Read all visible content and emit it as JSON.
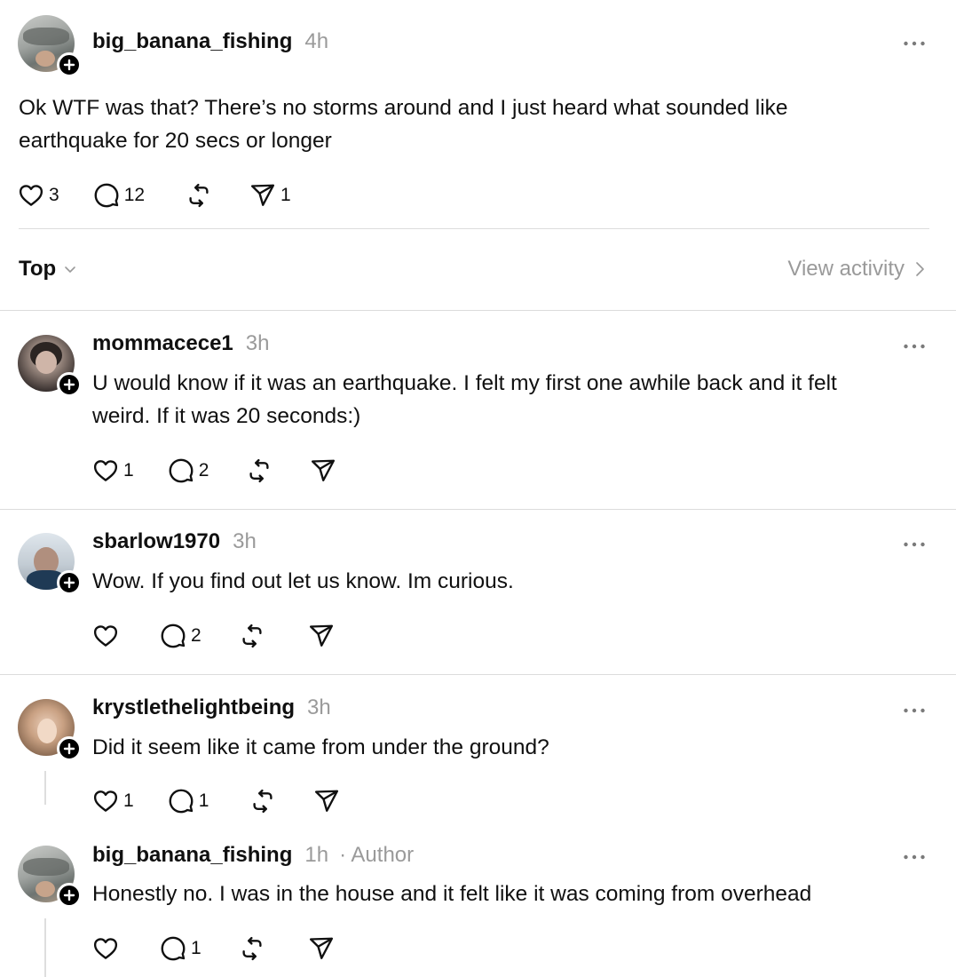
{
  "post": {
    "username": "big_banana_fishing",
    "time": "4h",
    "text_line1": "Ok WTF was that? There’s no storms around and I just heard what sounded like",
    "text_line2": "earthquake for 20 secs or longer",
    "likes": "3",
    "replies": "12",
    "shares": "1"
  },
  "sort": {
    "label": "Top",
    "view_activity": "View activity"
  },
  "comments": [
    {
      "username": "mommacece1",
      "time": "3h",
      "text_line1": "U would know if it was an earthquake. I felt my first one awhile back and it felt",
      "text_line2": "weird. If it was 20 seconds:)",
      "likes": "1",
      "replies": "2"
    },
    {
      "username": "sbarlow1970",
      "time": "3h",
      "text_line1": "Wow. If you find out let us know. Im curious.",
      "replies": "2"
    },
    {
      "username": "krystlethelightbeing",
      "time": "3h",
      "text_line1": "Did it seem like it came from under the ground?",
      "likes": "1",
      "replies": "1"
    },
    {
      "username": "big_banana_fishing",
      "time": "1h",
      "author": "· Author",
      "text_line1": "Honestly no. I was in the house and it felt like it was coming from overhead",
      "replies": "1"
    }
  ],
  "icons": {
    "like": "heart-icon",
    "reply": "comment-icon",
    "repost": "repost-icon",
    "share": "send-icon",
    "more": "more-horizontal-icon",
    "follow": "plus-icon"
  }
}
